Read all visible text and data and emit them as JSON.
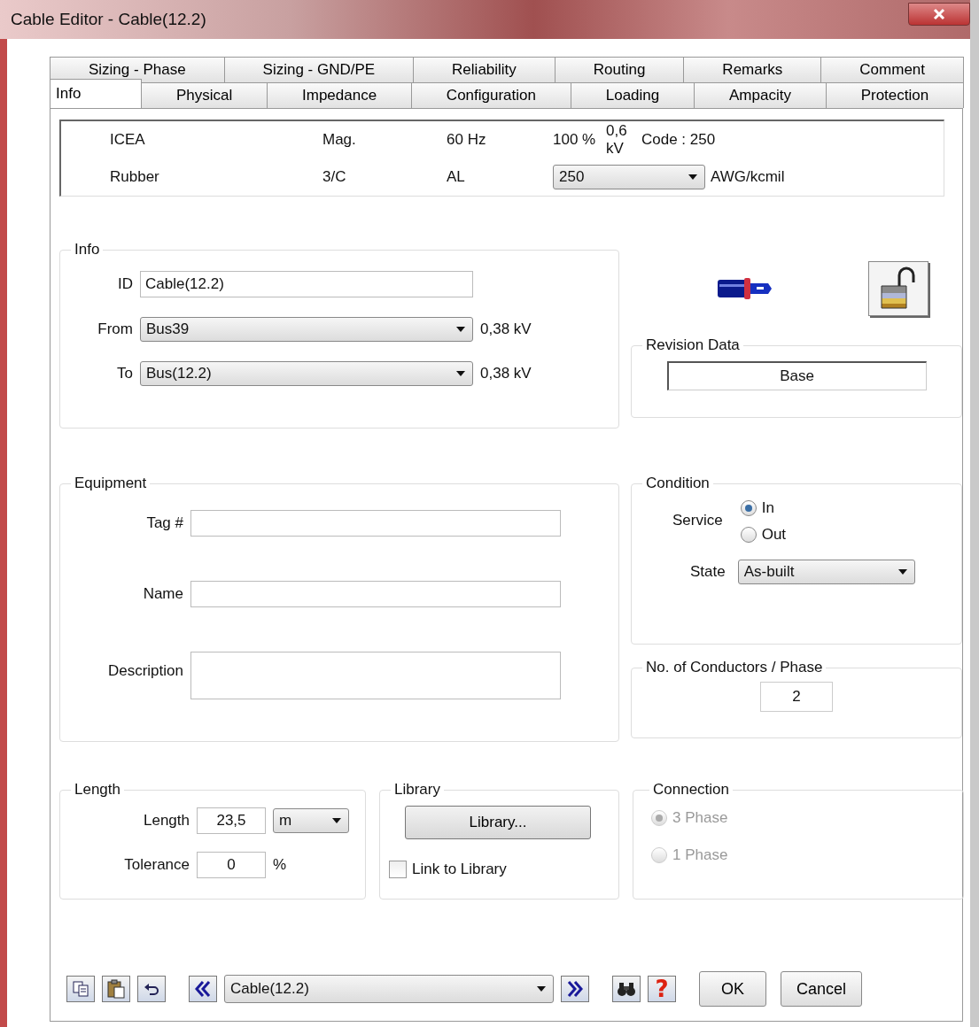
{
  "window": {
    "title": "Cable Editor - Cable(12.2)"
  },
  "tabs": [
    [
      {
        "label": "Sizing - Phase",
        "selected": false
      },
      {
        "label": "Sizing - GND/PE",
        "selected": false
      },
      {
        "label": "Reliability",
        "selected": false
      },
      {
        "label": "Routing",
        "selected": false
      },
      {
        "label": "Remarks",
        "selected": false
      },
      {
        "label": "Comment",
        "selected": false
      }
    ],
    [
      {
        "label": "Info",
        "selected": true
      },
      {
        "label": "Physical",
        "selected": false
      },
      {
        "label": "Impedance",
        "selected": false
      },
      {
        "label": "Configuration",
        "selected": false
      },
      {
        "label": "Loading",
        "selected": false
      },
      {
        "label": "Ampacity",
        "selected": false
      },
      {
        "label": "Protection",
        "selected": false
      }
    ]
  ],
  "summary": {
    "standard": "ICEA",
    "type": "Mag.",
    "frequency": "60 Hz",
    "code": "Code : 250",
    "insulation": "Rubber",
    "rating": "100 %",
    "voltage": "0,6 kV",
    "conductors": "3/C",
    "material": "AL",
    "size": "250",
    "size_unit": "AWG/kcmil"
  },
  "info": {
    "title": "Info",
    "id_label": "ID",
    "id_value": "Cable(12.2)",
    "from_label": "From",
    "from_value": "Bus39",
    "from_kv": "0,38 kV",
    "to_label": "To",
    "to_value": "Bus(12.2)",
    "to_kv": "0,38 kV"
  },
  "revision": {
    "title": "Revision Data",
    "value": "Base"
  },
  "equipment": {
    "title": "Equipment",
    "tag_label": "Tag #",
    "name_label": "Name",
    "description_label": "Description"
  },
  "condition": {
    "title": "Condition",
    "service_label": "Service",
    "service_options": [
      {
        "label": "In",
        "selected": true
      },
      {
        "label": "Out",
        "selected": false
      }
    ],
    "state_label": "State",
    "state_value": "As-built"
  },
  "conductors": {
    "title": "No. of Conductors / Phase",
    "value": "2"
  },
  "length": {
    "title": "Length",
    "length_label": "Length",
    "length_value": "23,5",
    "length_unit": "m",
    "tolerance_label": "Tolerance",
    "tolerance_value": "0",
    "tolerance_unit": "%"
  },
  "library": {
    "title": "Library",
    "button": "Library...",
    "link_label": "Link to Library",
    "link_checked": false
  },
  "connection": {
    "title": "Connection",
    "disabled": true,
    "options": [
      {
        "label": "3 Phase",
        "selected": true
      },
      {
        "label": "1 Phase",
        "selected": false
      }
    ]
  },
  "footer": {
    "element": "Cable(12.2)",
    "help": "?",
    "ok": "OK",
    "cancel": "Cancel"
  }
}
